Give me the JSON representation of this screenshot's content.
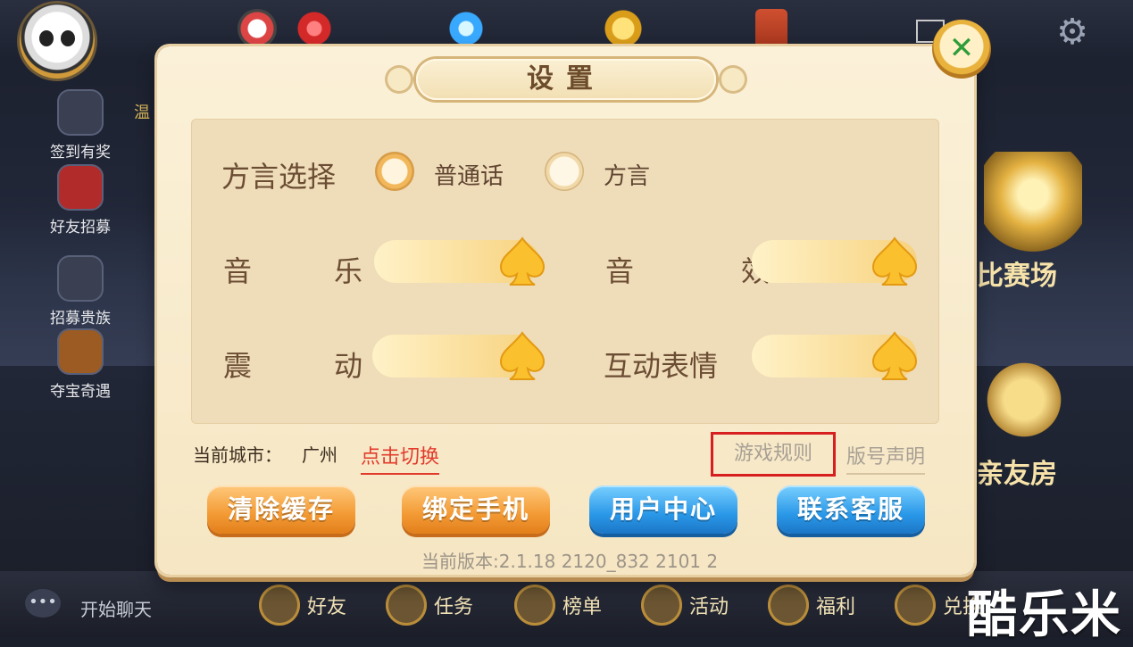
{
  "background": {
    "left_menu": [
      {
        "label": "签到有奖",
        "icon": "calendar-check-icon"
      },
      {
        "label": "好友招募",
        "icon": "red-envelope-icon"
      },
      {
        "label": "招募贵族",
        "icon": "handshake-icon"
      },
      {
        "label": "夺宝奇遇",
        "icon": "treasure-chest-icon"
      }
    ],
    "side_text_left": "温",
    "right_tags": [
      "比赛场",
      "亲友房"
    ],
    "chat_label": "开始聊天",
    "bottom_nav": [
      {
        "label": "好友",
        "icon": "friends-icon"
      },
      {
        "label": "任务",
        "icon": "task-icon"
      },
      {
        "label": "榜单",
        "icon": "ranking-icon"
      },
      {
        "label": "活动",
        "icon": "activity-icon"
      },
      {
        "label": "福利",
        "icon": "gift-icon"
      },
      {
        "label": "兑换",
        "icon": "exchange-icon"
      }
    ],
    "watermark": "酷乐米"
  },
  "dialog": {
    "title": "设置",
    "dialect": {
      "label": "方言选择",
      "options": [
        {
          "label": "普通话",
          "selected": true
        },
        {
          "label": "方言",
          "selected": false
        }
      ]
    },
    "sliders": [
      {
        "label": "音　乐",
        "value": 1.0
      },
      {
        "label": "音　效",
        "value": 1.0
      },
      {
        "label": "震　动",
        "value": 1.0
      },
      {
        "label": "互动表情",
        "value": 1.0
      }
    ],
    "city_prefix": "当前城市：",
    "city_name": "广州",
    "switch_city": "点击切换",
    "game_rules": "游戏规则",
    "version_statement": "版号声明",
    "buttons": {
      "clear_cache": "清除缓存",
      "bind_phone": "绑定手机",
      "user_center": "用户中心",
      "contact_service": "联系客服"
    },
    "version": "当前版本:2.1.18 2120_832 2101 2"
  },
  "colors": {
    "accent_orange": "#f39a34",
    "accent_blue": "#2a98e8",
    "link_red": "#e23b2b",
    "highlight_box": "#d71f1f"
  }
}
